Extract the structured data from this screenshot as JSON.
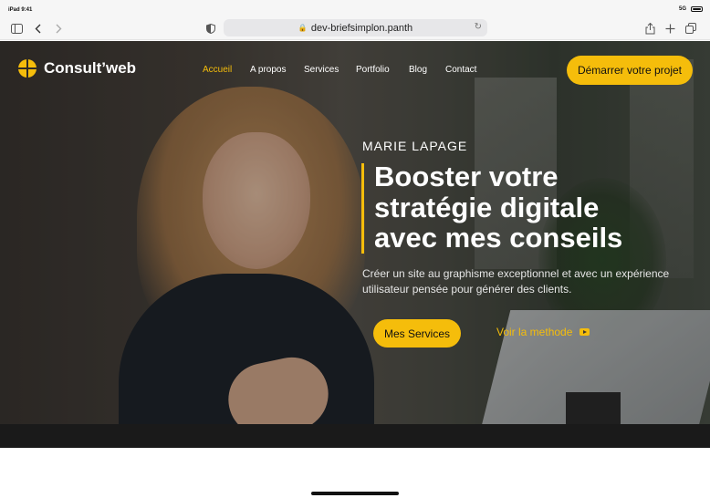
{
  "status_bar": {
    "time": "iPad 9:41",
    "signal": "5G"
  },
  "browser": {
    "url": "dev-briefsimplon.panth"
  },
  "site": {
    "brand": "Consult’web",
    "nav": [
      {
        "label": "Accueil",
        "active": true
      },
      {
        "label": "A propos",
        "active": false
      },
      {
        "label": "Services",
        "active": false
      },
      {
        "label": "Portfolio",
        "active": false
      },
      {
        "label": "Blog",
        "active": false
      },
      {
        "label": "Contact",
        "active": false
      }
    ],
    "cta_label": "Démarrer votre projet"
  },
  "hero": {
    "eyebrow": "MARIE  LAPAGE",
    "title_line1": "Booster votre",
    "title_line2": "stratégie digitale",
    "title_line3": "avec mes conseils",
    "subtitle_line1": "Créer un site au graphisme exceptionnel et avec un expérience",
    "subtitle_line2": "utilisateur pensée pour générer des clients.",
    "primary_button": "Mes Services",
    "secondary_button": "Voir la methode"
  },
  "colors": {
    "accent": "#f5bd0b",
    "text_light": "#ffffff"
  }
}
